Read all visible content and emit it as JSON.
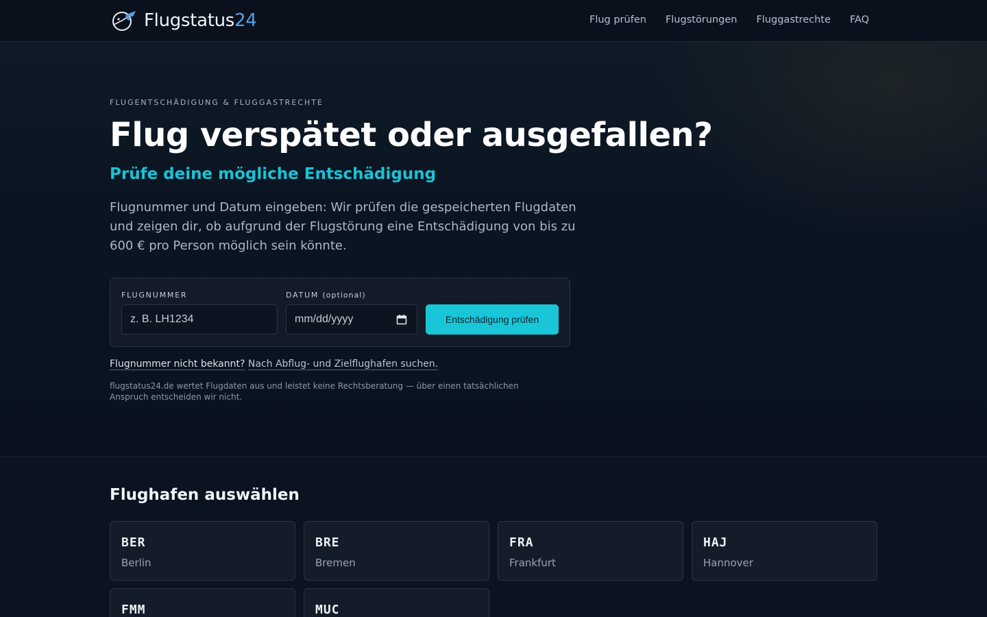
{
  "header": {
    "logo_text": "Flugstatus",
    "logo_num": "24",
    "nav": [
      "Flug prüfen",
      "Flugstörungen",
      "Fluggastrechte",
      "FAQ"
    ]
  },
  "hero": {
    "eyebrow": "FLUGENTSCHÄDIGUNG & FLUGGASTRECHTE",
    "title": "Flug verspätet oder ausgefallen?",
    "subtitle": "Prüfe deine mögliche Entschädigung",
    "lead": "Flugnummer und Datum eingeben: Wir prüfen die gespeicherten Flugdaten und zeigen dir, ob aufgrund der Flugstörung eine Entschädigung von bis zu 600 € pro Person möglich sein könnte."
  },
  "form": {
    "flight_label": "FLUGNUMMER",
    "flight_placeholder": "z. B. LH1234",
    "date_label": "DATUM",
    "date_optional": "(optional)",
    "date_placeholder": "mm/dd/yyyy",
    "submit_label": "Entschädigung prüfen"
  },
  "hint": {
    "question": "Flugnummer nicht bekannt?",
    "link": "Nach Abflug- und Zielflughafen suchen."
  },
  "disclaimer": "flugstatus24.de wertet Flugdaten aus und leistet keine Rechtsberatung — über einen tatsächlichen Anspruch entscheiden wir nicht.",
  "airports": {
    "title": "Flughafen auswählen",
    "items": [
      {
        "code": "BER",
        "city": "Berlin"
      },
      {
        "code": "BRE",
        "city": "Bremen"
      },
      {
        "code": "FRA",
        "city": "Frankfurt"
      },
      {
        "code": "HAJ",
        "city": "Hannover"
      },
      {
        "code": "FMM",
        "city": ""
      },
      {
        "code": "MUC",
        "city": ""
      }
    ]
  },
  "colors": {
    "background": "#0b1220",
    "accent": "#19c6d8",
    "logo_accent": "#5aa0e6"
  }
}
